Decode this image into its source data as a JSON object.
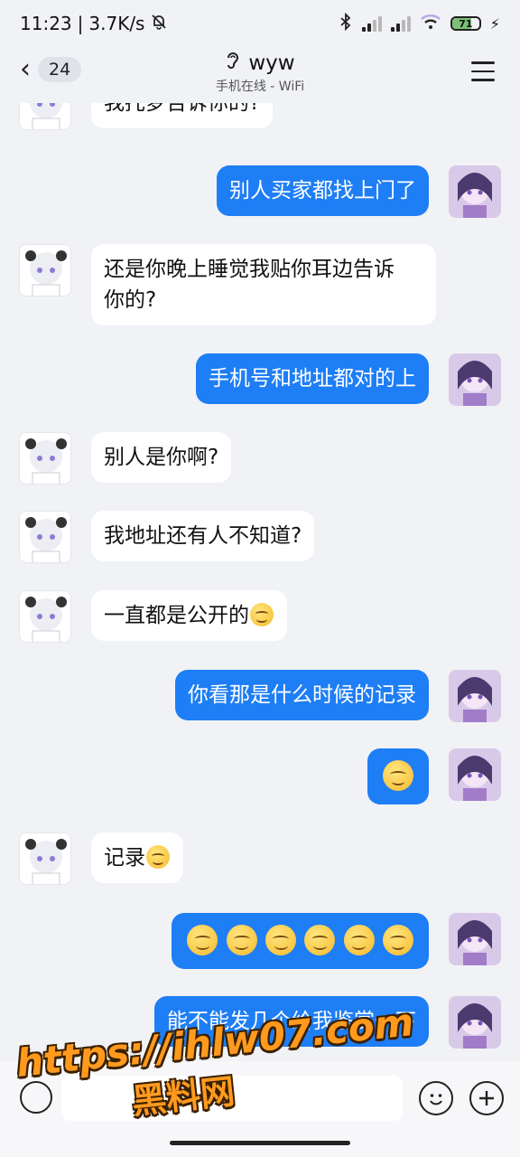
{
  "status_bar": {
    "time": "11:23",
    "net_speed": "3.7K/s",
    "battery": "71",
    "battery_level": 0.71
  },
  "header": {
    "back_count": "24",
    "title": "wyw",
    "subtitle": "手机在线 - WiFi"
  },
  "messages": [
    {
      "from": "other",
      "text": "我托梦告诉你的?"
    },
    {
      "from": "me",
      "text": "别人买家都找上门了"
    },
    {
      "from": "other",
      "line1": "还是你晚上睡觉我贴你耳边告诉",
      "line2": "你的?"
    },
    {
      "from": "me",
      "text": "手机号和地址都对的上"
    },
    {
      "from": "other",
      "text": "别人是你啊?"
    },
    {
      "from": "other",
      "text": "我地址还有人不知道?"
    },
    {
      "from": "other",
      "text": "一直都是公开的",
      "emoji": "yum-emoji"
    },
    {
      "from": "me",
      "text": "你看那是什么时候的记录"
    },
    {
      "from": "me",
      "emoji": "yum-emoji"
    },
    {
      "from": "other",
      "text": "记录",
      "emoji": "yum-emoji"
    },
    {
      "from": "me",
      "emoji_count": 6,
      "emoji": "yum-emoji"
    },
    {
      "from": "me",
      "text": "能不能发几个给我鉴赏一下"
    }
  ],
  "watermark": {
    "url": "https://ihlw07.com",
    "name": "黑料网"
  },
  "colors": {
    "my_bubble": "#1e7ef5",
    "other_bubble": "#ffffff",
    "background": "#f1f2f6"
  }
}
